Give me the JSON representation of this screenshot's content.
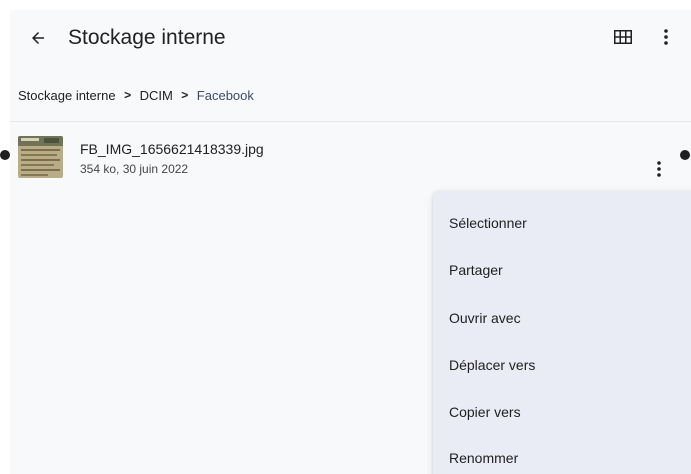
{
  "app_bar": {
    "back_icon": "arrow-back-icon",
    "title": "Stockage interne",
    "grid_icon": "grid-view-icon",
    "more_icon": "more-vert-icon"
  },
  "breadcrumb": {
    "items": [
      "Stockage interne",
      "DCIM",
      "Facebook"
    ],
    "separator_icon": "chevron-right-icon"
  },
  "files": [
    {
      "name": "FB_IMG_1656621418339.jpg",
      "meta": "354 ko, 30 juin 2022",
      "thumbnail_icon": "image-thumbnail",
      "more_icon": "more-vert-icon"
    }
  ],
  "context_menu": {
    "items": [
      "Sélectionner",
      "Partager",
      "Ouvrir avec",
      "Déplacer vers",
      "Copier vers",
      "Renommer"
    ]
  },
  "colors": {
    "background": "#f8f9fa",
    "menu_background": "#e9ebf5",
    "current_crumb": "#3c4a70",
    "text": "#202124"
  }
}
